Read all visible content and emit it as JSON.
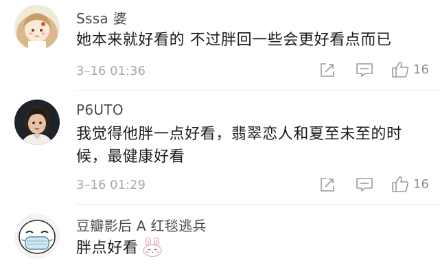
{
  "comments": [
    {
      "username": "Sssa 婆",
      "text": "她本来就好看的 不过胖回一些会更好看点而已",
      "time": "3–16 01:36",
      "likes": "16",
      "avatar_icon": "cartoon-girl-avatar"
    },
    {
      "username": "P6UTO",
      "text": "我觉得他胖一点好看，翡翠恋人和夏至未至的时候，最健康好看",
      "time": "3–16 01:29",
      "likes": "16",
      "avatar_icon": "girl-portrait-avatar"
    },
    {
      "username": "豆瓣影后 A 红毯逃兵",
      "text": "胖点好看",
      "emoji": "bunny-emoji",
      "avatar_icon": "masked-face-meme-avatar"
    }
  ],
  "colors": {
    "username": "#4a4a4a",
    "text": "#1b1b1b",
    "meta": "#a8a8a8",
    "icon": "#9a9a9a"
  }
}
